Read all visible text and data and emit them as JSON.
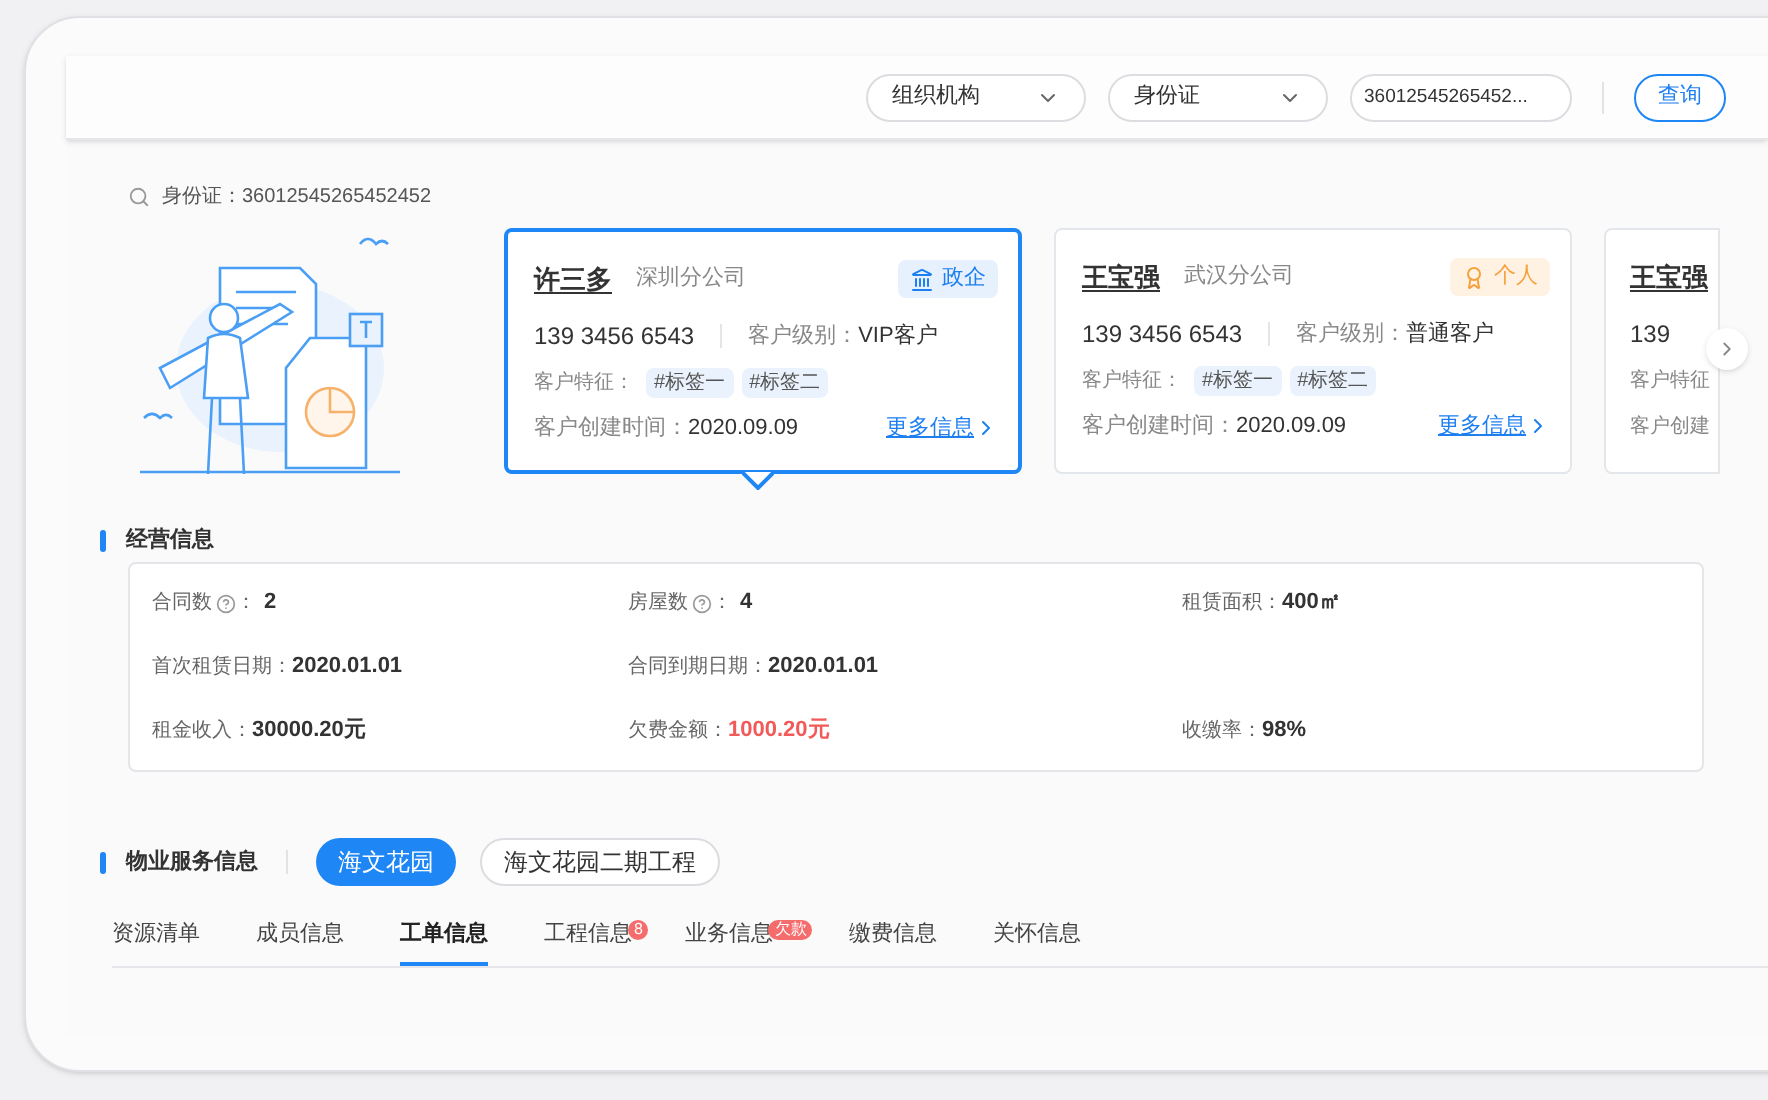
{
  "toolbar": {
    "filters": [
      {
        "kind": "select",
        "value": "组织机构"
      },
      {
        "kind": "select",
        "value": "身份证"
      },
      {
        "kind": "input",
        "value": "36012545265452..."
      }
    ],
    "button": "查询"
  },
  "search_summary": "身份证：36012545265452452",
  "customers": [
    {
      "name": "许三多",
      "branch": "深圳分公司",
      "kind": "gov",
      "type_label": "政企",
      "phone": "139 3456 6543",
      "level_label": "客户级别：",
      "level": "VIP客户",
      "feature_label": "客户特征：",
      "tags": [
        "#标签一",
        "#标签二"
      ],
      "created_label": "客户创建时间：",
      "created": "2020.09.09",
      "more": "更多信息",
      "selected": true
    },
    {
      "name": "王宝强",
      "branch": "武汉分公司",
      "kind": "personal",
      "type_label": "个人",
      "phone": "139 3456 6543",
      "level_label": "客户级别：",
      "level": "普通客户",
      "feature_label": "客户特征：",
      "tags": [
        "#标签一",
        "#标签二"
      ],
      "created_label": "客户创建时间：",
      "created": "2020.09.09",
      "more": "更多信息",
      "selected": false
    },
    {
      "name": "王宝强",
      "phone": "139",
      "feature_label": "客户特征",
      "created_label": "客户创建",
      "selected": false
    }
  ],
  "business": {
    "title": "经营信息",
    "rows": [
      [
        {
          "label": "合同数",
          "help": true,
          "colon": "：",
          "value": "2",
          "kind": "normal"
        },
        {
          "label": "房屋数",
          "help": true,
          "colon": "：",
          "value": "4",
          "kind": "normal"
        },
        {
          "label": "租赁面积：",
          "help": false,
          "value": "400㎡",
          "kind": "normal"
        }
      ],
      [
        {
          "label": "首次租赁日期：",
          "help": false,
          "value": "2020.01.01",
          "kind": "normal"
        },
        {
          "label": "合同到期日期：",
          "help": false,
          "value": "2020.01.01",
          "kind": "normal"
        }
      ],
      [
        {
          "label": "租金收入：",
          "help": false,
          "value": "30000.20元",
          "kind": "normal"
        },
        {
          "label": "欠费金额：",
          "help": false,
          "value": "1000.20元",
          "kind": "alert"
        },
        {
          "label": "收缴率：",
          "help": false,
          "value": "98%",
          "kind": "normal"
        }
      ]
    ]
  },
  "property": {
    "title": "物业服务信息",
    "projects": [
      {
        "label": "海文花园",
        "selected": true
      },
      {
        "label": "海文花园二期工程",
        "selected": false
      }
    ],
    "tabs": [
      {
        "label": "资源清单",
        "selected": false
      },
      {
        "label": "成员信息",
        "selected": false
      },
      {
        "label": "工单信息",
        "selected": true
      },
      {
        "label": "工程信息",
        "selected": false,
        "badge": "8"
      },
      {
        "label": "业务信息",
        "selected": false,
        "badge": "欠款"
      },
      {
        "label": "缴费信息",
        "selected": false
      },
      {
        "label": "关怀信息",
        "selected": false
      }
    ]
  }
}
